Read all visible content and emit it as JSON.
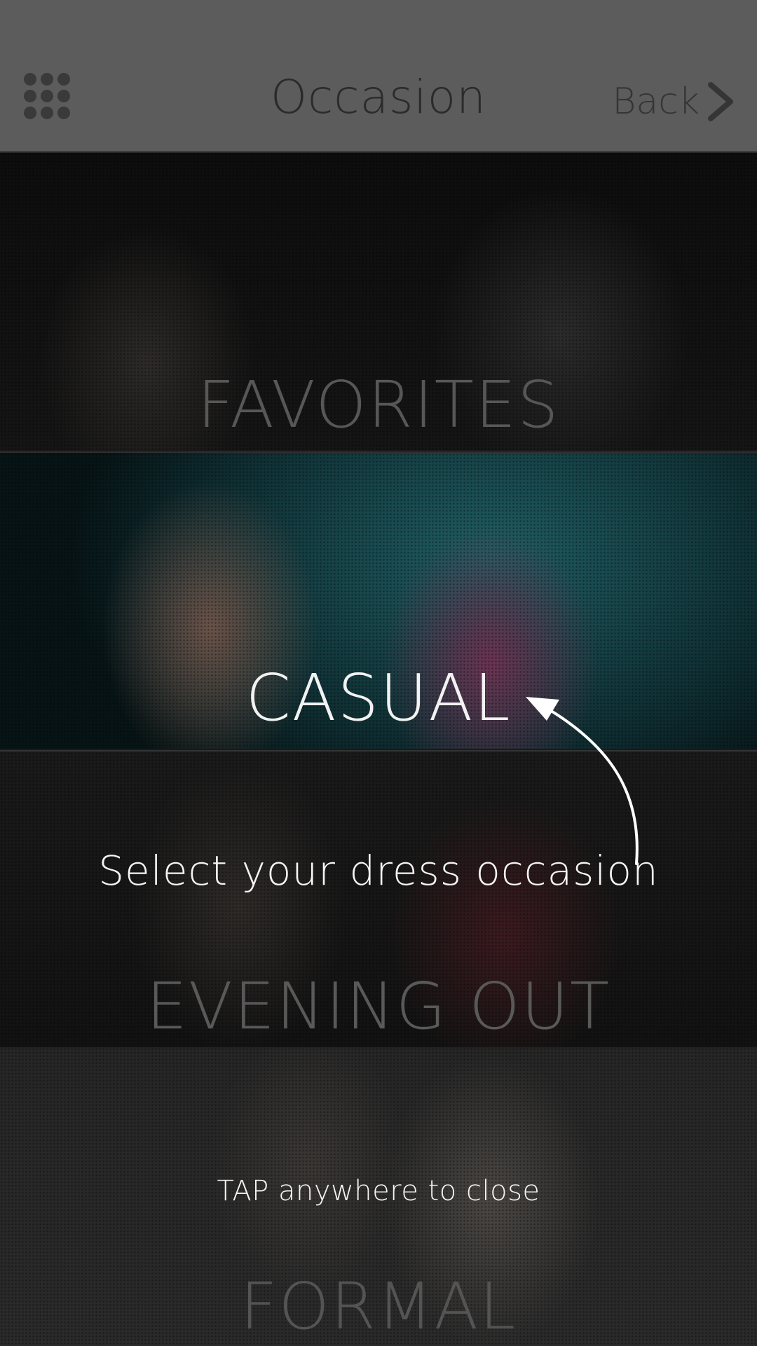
{
  "header": {
    "title": "Occasion",
    "menu_icon": "grid-menu-icon",
    "back_label": "Back",
    "back_icon": "chevron-right-icon"
  },
  "occasions": [
    {
      "label": "FAVORITES"
    },
    {
      "label": "CASUAL"
    },
    {
      "label": "EVENING OUT"
    },
    {
      "label": "FORMAL"
    }
  ],
  "overlay": {
    "hint_text": "Select your dress occasion",
    "close_text": "TAP anywhere to close",
    "arrow_icon": "curved-arrow-icon"
  },
  "colors": {
    "header_bg": "#5c5c5c",
    "active_label": "#f2f2f2",
    "inactive_label": "#575757"
  }
}
